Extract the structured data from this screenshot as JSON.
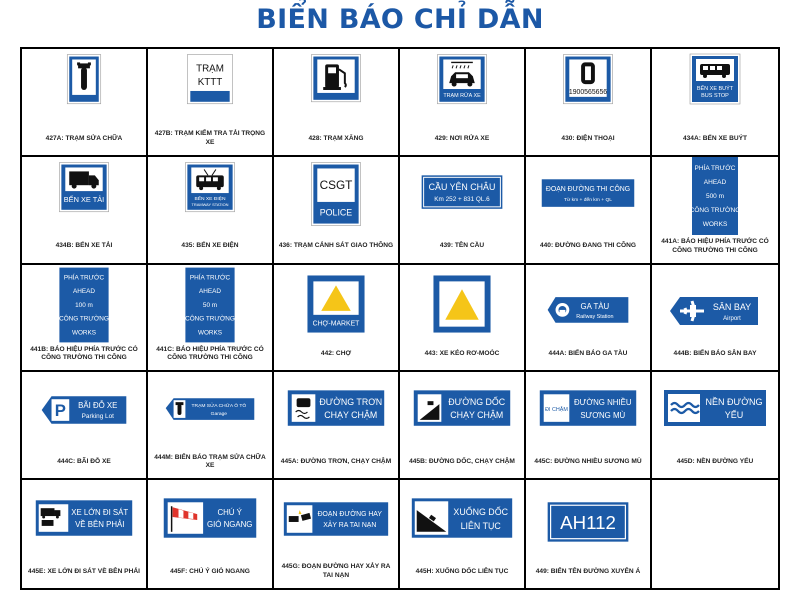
{
  "title": "BIỂN BÁO CHỈ DẪN",
  "colors": {
    "sign_blue": "#1c5aa6",
    "title_blue": "#1c58a6",
    "icon_yellow": "#f5c518"
  },
  "signs": [
    {
      "caption": "427A: TRẠM SỬA CHỮA",
      "icon": "wrench-icon"
    },
    {
      "caption": "427B: TRẠM KIỂM TRA TẢI TRỌNG XE",
      "text1": "TRẠM",
      "text2": "KTTT"
    },
    {
      "caption": "428: TRẠM XĂNG",
      "icon": "fuel-pump-icon"
    },
    {
      "caption": "429: NƠI RỬA XE",
      "icon": "car-wash-icon",
      "text1": "TRẠM RỬA XE"
    },
    {
      "caption": "430: ĐIỆN THOẠI",
      "icon": "telephone-icon",
      "text1": "1900565656"
    },
    {
      "caption": "434A: BẾN XE BUÝT",
      "icon": "bus-icon",
      "text1": "BẾN XE BUÝT",
      "text2": "BUS STOP"
    },
    {
      "caption": "434B: BẾN XE TẢI",
      "icon": "truck-icon",
      "text1": "BẾN XE TẢI"
    },
    {
      "caption": "435: BẾN XE ĐIỆN",
      "icon": "tram-icon",
      "text1": "BẾN XE ĐIỆN",
      "text2": "TRAMWAY STATION"
    },
    {
      "caption": "436: TRẠM CẢNH SÁT GIAO THÔNG",
      "text1": "CSGT",
      "text2": "POLICE"
    },
    {
      "caption": "439: TÊN CẦU",
      "text1": "CẦU YÊN CHÂU",
      "text2": "Km 252 + 831 QL.6"
    },
    {
      "caption": "440: ĐƯỜNG ĐANG THI CÔNG",
      "text1": "ĐOẠN ĐƯỜNG THI CÔNG",
      "text2": "Từ km + đến km + QL"
    },
    {
      "caption": "441A: BÁO HIỆU PHÍA TRƯỚC CÓ CÔNG TRƯỜNG THI CÔNG",
      "lines": [
        "PHÍA TRƯỚC",
        "AHEAD",
        "500 m",
        "CÔNG TRƯỜNG",
        "WORKS"
      ]
    },
    {
      "caption": "441B: BÁO HIỆU PHÍA TRƯỚC CÓ CÔNG TRƯỜNG THI CÔNG",
      "lines": [
        "PHÍA TRƯỚC",
        "AHEAD",
        "100 m",
        "CÔNG TRƯỜNG",
        "WORKS"
      ]
    },
    {
      "caption": "441C: BÁO HIỆU PHÍA TRƯỚC CÓ CÔNG TRƯỜNG THI CÔNG",
      "lines": [
        "PHÍA TRƯỚC",
        "AHEAD",
        "50 m",
        "CÔNG TRƯỜNG",
        "WORKS"
      ]
    },
    {
      "caption": "442: CHỢ",
      "icon": "triangle-icon",
      "text1": "CHỢ-MARKET"
    },
    {
      "caption": "443: XE KÉO RƠ-MOÓC",
      "icon": "triangle-icon"
    },
    {
      "caption": "444A: BIỂN BÁO GA TÀU",
      "icon": "railway-icon",
      "text1": "GA TÀU",
      "text2": "Railway Station"
    },
    {
      "caption": "444B: BIỂN BÁO SÂN BAY",
      "icon": "airplane-icon",
      "text1": "SÂN BAY",
      "text2": "Airport"
    },
    {
      "caption": "444C: BÃI ĐỖ XE",
      "icon": "parking-icon",
      "text1": "BÃI ĐỖ XE",
      "text2": "Parking Lot"
    },
    {
      "caption": "444M: BIỂN BÁO TRẠM SỬA CHỮA XE",
      "icon": "wrench-icon",
      "text1": "TRẠM SỬA CHỮA Ô TÔ",
      "text2": "Garage"
    },
    {
      "caption": "445A: ĐƯỜNG TRƠN, CHẠY CHẬM",
      "icon": "slippery-car-icon",
      "text1": "ĐƯỜNG TRƠN",
      "text2": "CHẠY CHẬM"
    },
    {
      "caption": "445B: ĐƯỜNG DỐC, CHẠY CHẬM",
      "icon": "slope-icon",
      "text1": "ĐƯỜNG DỐC",
      "text2": "CHẠY CHẬM"
    },
    {
      "caption": "445C: ĐƯỜNG NHIỀU SƯƠNG MÙ",
      "text0": "ĐI CHẬM",
      "text1": "ĐƯỜNG NHIỀU",
      "text2": "SƯƠNG MÙ"
    },
    {
      "caption": "445D: NỀN ĐƯỜNG YẾU",
      "icon": "waves-icon",
      "text1": "NỀN ĐƯỜNG",
      "text2": "YẾU"
    },
    {
      "caption": "445E: XE LỚN ĐI SÁT VỀ BÊN PHẢI",
      "icon": "vehicles-icon",
      "text1": "XE LỚN ĐI SÁT",
      "text2": "VỀ BÊN PHẢI"
    },
    {
      "caption": "445F: CHÚ Ý GIÓ NGANG",
      "icon": "windsock-icon",
      "text1": "CHÚ Ý",
      "text2": "GIÓ NGANG"
    },
    {
      "caption": "445G: ĐOẠN ĐƯỜNG HAY XẢY RA TAI NẠN",
      "icon": "crash-icon",
      "text1": "ĐOẠN ĐƯỜNG HAY",
      "text2": "XẢY RA TAI NẠN"
    },
    {
      "caption": "445H: XUỐNG DỐC LIÊN TỤC",
      "icon": "downhill-icon",
      "text1": "XUỐNG DỐC",
      "text2": "LIÊN TỤC"
    },
    {
      "caption": "449: BIỂN TÊN ĐƯỜNG XUYÊN Á",
      "text1": "AH112"
    },
    {
      "caption": ""
    }
  ]
}
